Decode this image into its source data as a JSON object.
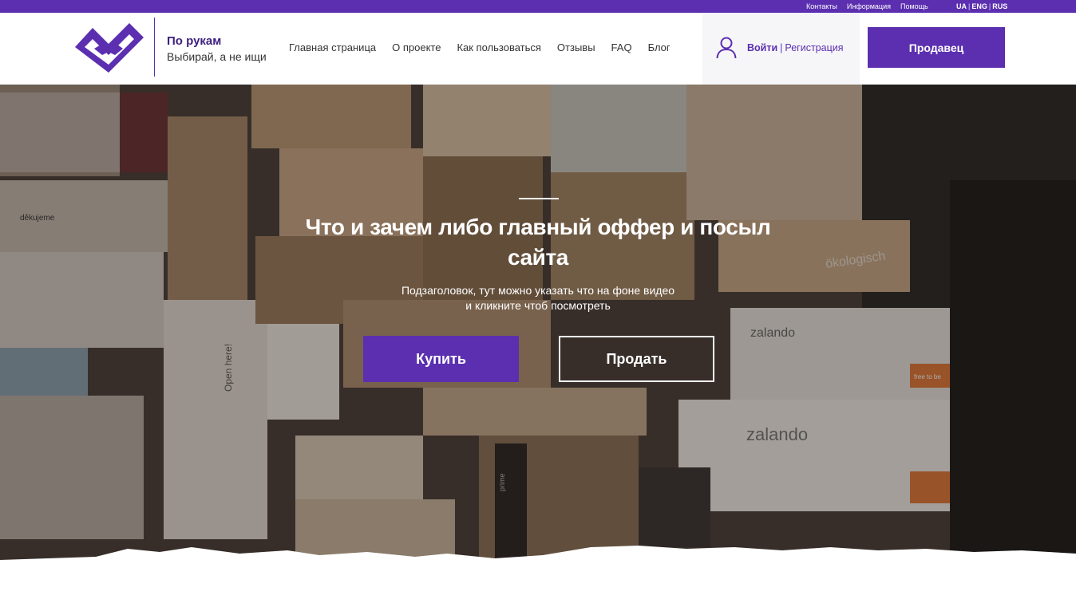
{
  "topbar": {
    "links": [
      "Контакты",
      "Информация",
      "Помощь"
    ],
    "languages": [
      "UA",
      "ENG",
      "RUS"
    ]
  },
  "brand": {
    "name": "По рукам",
    "slogan": "Выбирай, а не ищи",
    "logo_icon": "handshake-check-icon"
  },
  "nav": {
    "items": [
      "Главная страница",
      "О проекте",
      "Как пользоваться",
      "Отзывы",
      "FAQ",
      "Блог"
    ]
  },
  "auth": {
    "icon": "user-icon",
    "login": "Войти",
    "register": "Регистрация"
  },
  "seller_button": "Продавец",
  "hero": {
    "title": "Что и зачем либо главный оффер и посыл сайта",
    "subtitle_line1": "Подзаголовок, тут можно указать что на фоне видео",
    "subtitle_line2": "и кликните чтоб посмотреть",
    "buy_label": "Купить",
    "sell_label": "Продать"
  },
  "background_box_labels": {
    "box1": "zalando",
    "box2": "zalando",
    "box3": "ökologisch",
    "box4": "Open here!",
    "box5": "free to be",
    "box6": "děkujeme",
    "box7": "prime"
  },
  "colors": {
    "brand_purple": "#5b2fb0",
    "white": "#ffffff"
  }
}
